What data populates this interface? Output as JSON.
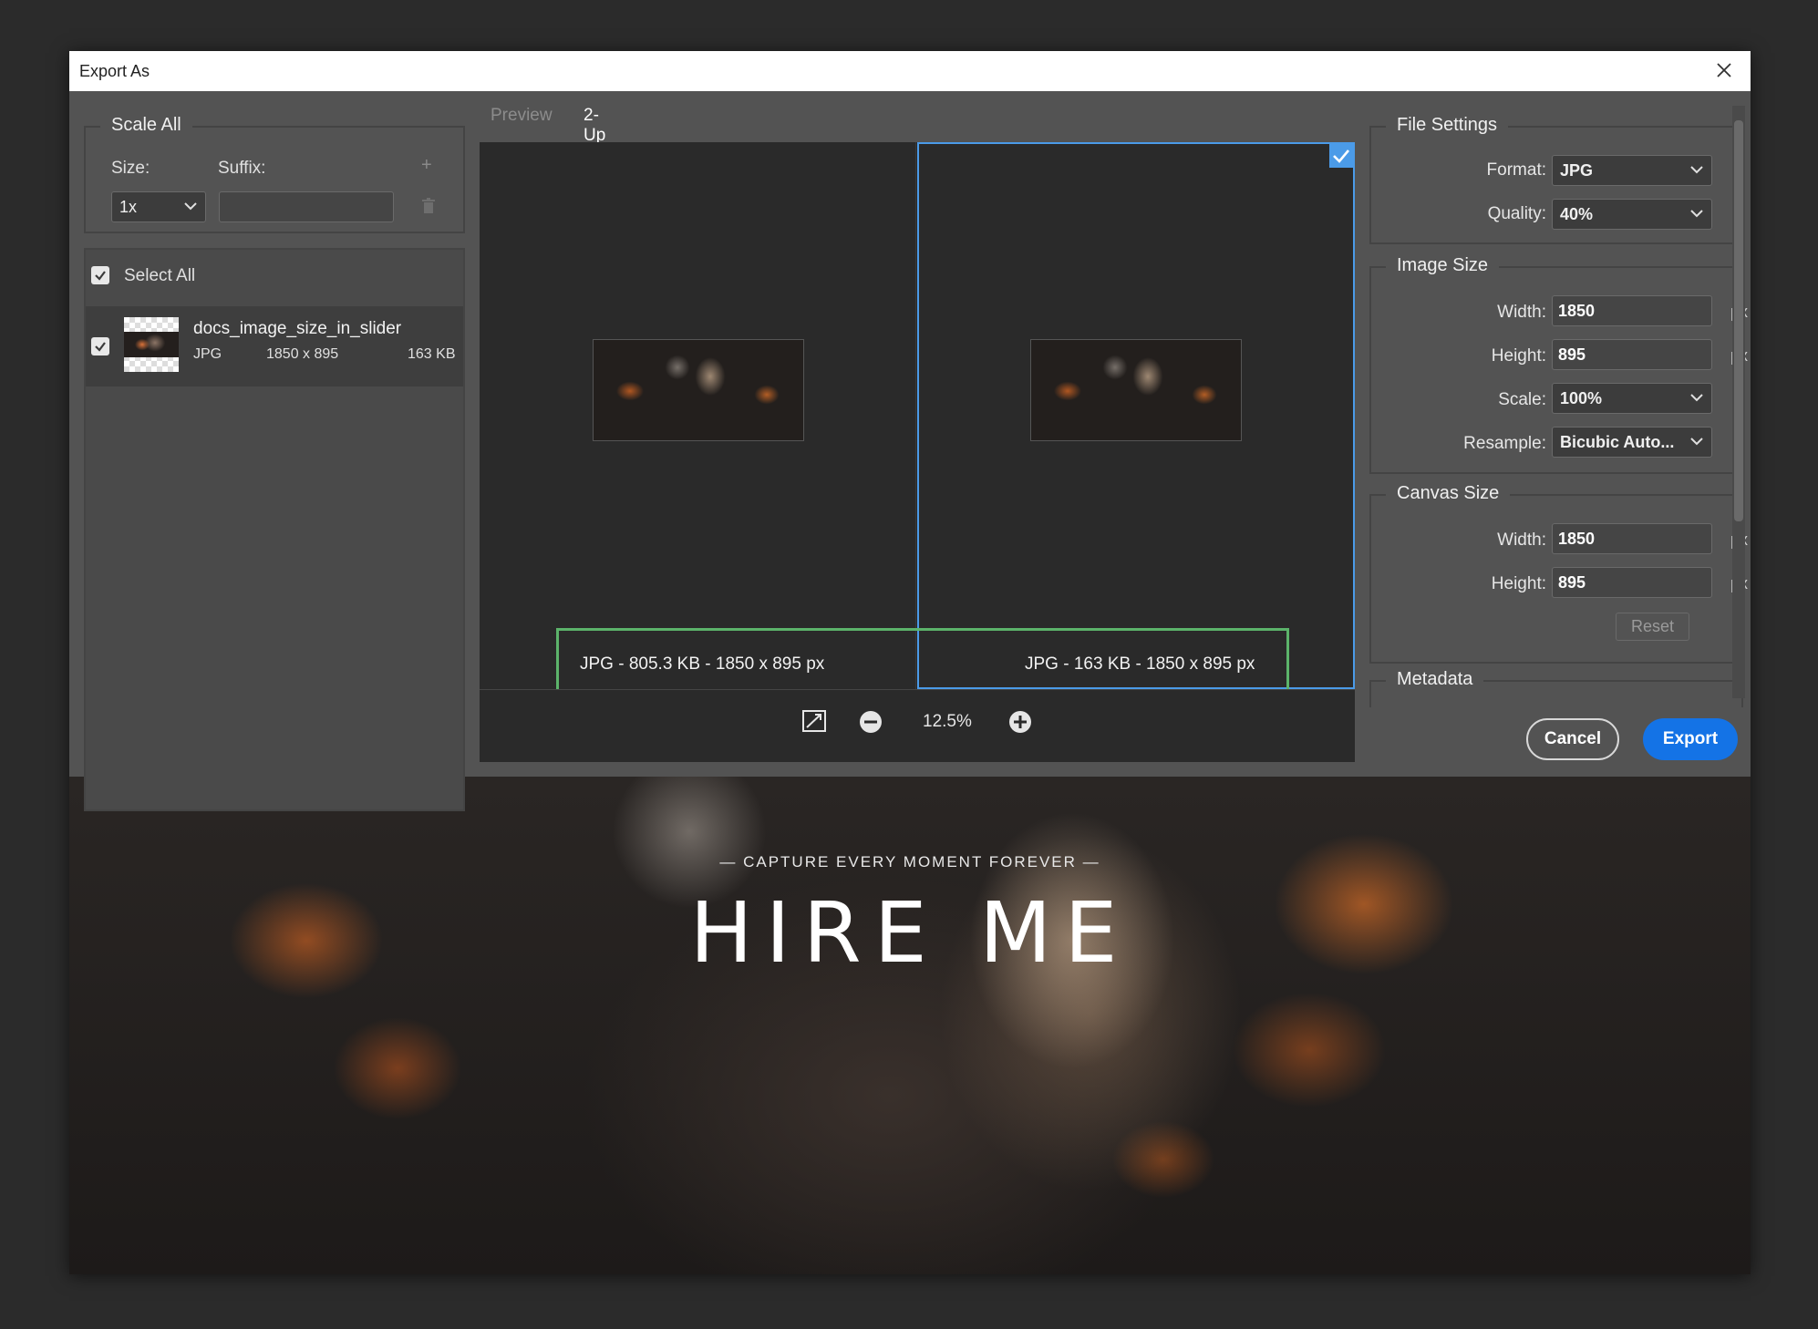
{
  "window": {
    "title": "Export As"
  },
  "left_panel": {
    "scale_all": {
      "legend": "Scale All",
      "size_label": "Size:",
      "suffix_label": "Suffix:",
      "size_value": "1x",
      "suffix_value": ""
    },
    "select_all_label": "Select All",
    "asset": {
      "name": "docs_image_size_in_slider",
      "format": "JPG",
      "dimensions": "1850 x 895",
      "size": "163 KB"
    }
  },
  "preview": {
    "tabs": [
      {
        "label": "Preview"
      },
      {
        "label": "2-Up"
      }
    ],
    "left_info": "JPG - 805.3 KB - 1850 x 895 px",
    "right_info": "JPG - 163 KB - 1850 x 895 px",
    "zoom": "12.5%"
  },
  "file_settings": {
    "legend": "File Settings",
    "format_label": "Format:",
    "format_value": "JPG",
    "quality_label": "Quality:",
    "quality_value": "40%"
  },
  "image_size": {
    "legend": "Image Size",
    "width_label": "Width:",
    "width_value": "1850",
    "height_label": "Height:",
    "height_value": "895",
    "unit": "px",
    "scale_label": "Scale:",
    "scale_value": "100%",
    "resample_label": "Resample:",
    "resample_value": "Bicubic Auto..."
  },
  "canvas_size": {
    "legend": "Canvas Size",
    "width_label": "Width:",
    "width_value": "1850",
    "height_label": "Height:",
    "height_value": "895",
    "unit": "px",
    "reset_label": "Reset"
  },
  "metadata": {
    "legend": "Metadata"
  },
  "actions": {
    "cancel_label": "Cancel",
    "export_label": "Export"
  },
  "hero": {
    "subtitle": "— CAPTURE EVERY MOMENT FOREVER —",
    "title": "HIRE ME"
  },
  "colors": {
    "accent": "#1473e6",
    "selection": "#4b9be8",
    "highlight": "#5cb36a"
  }
}
